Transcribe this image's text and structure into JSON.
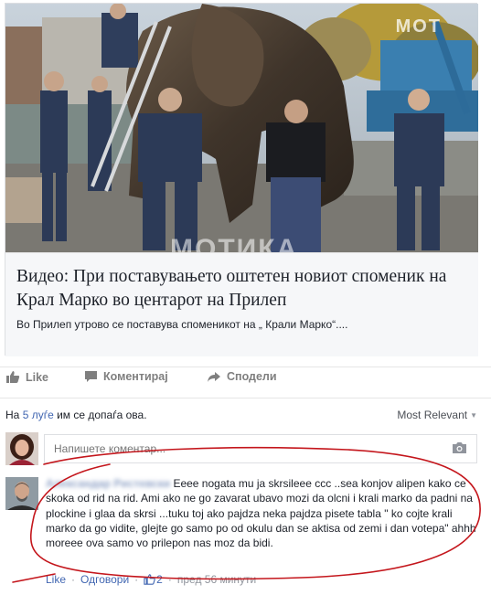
{
  "post": {
    "photo": {
      "watermark_top": "MOT",
      "watermark_bottom": "МОТИКА"
    },
    "link": {
      "title": "Видео: При поставувањето оштетен новиот споменик на Крал Марко во центарот на Прилеп",
      "description": "Во Прилеп утрово се поставува споменикот на „ Крали Марко“...."
    }
  },
  "actions": {
    "like": "Like",
    "comment": "Коментирај",
    "share": "Сподели"
  },
  "likes": {
    "prefix": "На ",
    "count": "5 луѓе",
    "suffix": " им се допаѓа ова."
  },
  "sort": {
    "label": "Most Relevant"
  },
  "comment_input": {
    "placeholder": "Напишете коментар..."
  },
  "comment": {
    "author": "Александар Ристевски",
    "text": "Eeee nogata mu ja skrsileee ccc ..sea konjov alipen kako ce skoka od rid na rid. Ami ako ne go zavarat ubavo mozi da olcni i krali marko da padni na plockine i glaa da skrsi ...tuku toj ako pajdza neka pajdza pisete tabla \" ko cojte krali marko da go vidite, glejte go samo po od okulu dan se aktisa od zemi i dan votepa\" ahhh moreee ova samo vo prilepon nas moz da bidi.",
    "like_label": "Like",
    "reply_label": "Одговори",
    "like_count": "2",
    "time": "пред 56 минути"
  },
  "colors": {
    "link_blue": "#4267b2",
    "annotation_red": "#c4161c",
    "card_bg": "#f6f7f9"
  },
  "icons": {
    "like": "thumbs-up-icon",
    "comment": "speech-bubble-icon",
    "share": "share-arrow-icon",
    "camera": "camera-icon",
    "sort_caret": "caret-down-icon"
  }
}
